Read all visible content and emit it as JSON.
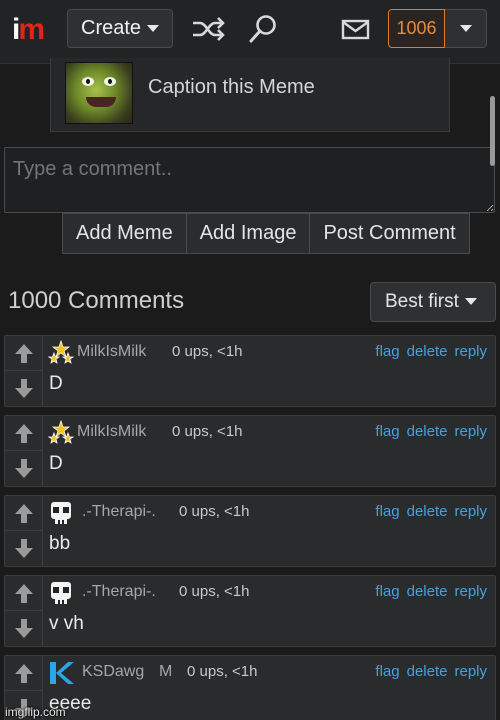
{
  "header": {
    "logo_i": "i",
    "logo_m": "m",
    "create_label": "Create",
    "notification_count": "1006"
  },
  "caption": {
    "text": "Caption this Meme"
  },
  "comment_box": {
    "placeholder": "Type a comment.."
  },
  "actions": {
    "add_meme": "Add Meme",
    "add_image": "Add Image",
    "post_comment": "Post Comment"
  },
  "comments_header": {
    "count_label": "1000 Comments",
    "sort_label": "Best first"
  },
  "comments": [
    {
      "user": "MilkIsMilk",
      "badge": "",
      "meta": "0 ups, <1h",
      "text": "D",
      "avatar": "stars-icon"
    },
    {
      "user": "MilkIsMilk",
      "badge": "",
      "meta": "0 ups, <1h",
      "text": "D",
      "avatar": "stars-icon"
    },
    {
      "user": ".-Therapi-.",
      "badge": "",
      "meta": "0 ups, <1h",
      "text": "bb",
      "avatar": "skull-icon"
    },
    {
      "user": ".-Therapi-.",
      "badge": "",
      "meta": "0 ups, <1h",
      "text": "v vh",
      "avatar": "skull-icon"
    },
    {
      "user": "KSDawg",
      "badge": "M",
      "meta": "0 ups, <1h",
      "text": "eeee",
      "avatar": "k-logo-icon"
    }
  ],
  "comment_links": {
    "flag": "flag",
    "delete": "delete",
    "reply": "reply"
  },
  "watermark": "imgflip.com",
  "colors": {
    "accent_link": "#3fa4e3",
    "notif_orange": "#e58a3c",
    "logo_red": "#e0251b"
  }
}
